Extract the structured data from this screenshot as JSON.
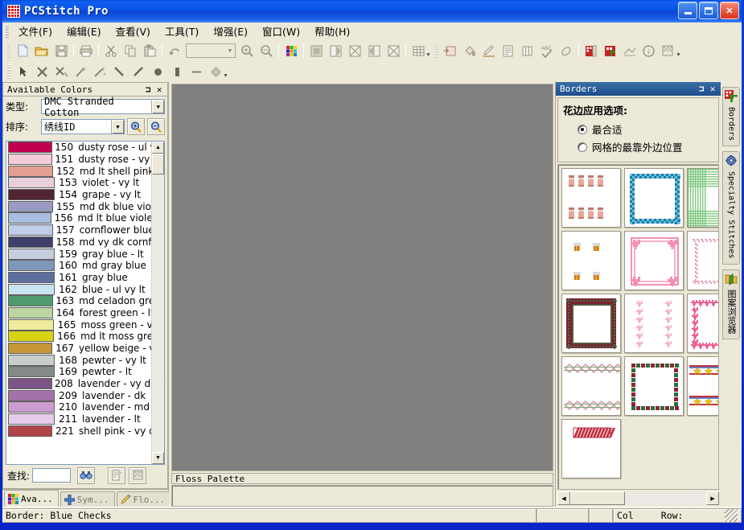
{
  "window": {
    "title": "PCStitch Pro",
    "minimize_label": "Minimize",
    "maximize_label": "Maximize",
    "close_label": "Close"
  },
  "menu": [
    {
      "label": "文件(F)",
      "name": "menu-file"
    },
    {
      "label": "编辑(E)",
      "name": "menu-edit"
    },
    {
      "label": "查看(V)",
      "name": "menu-view"
    },
    {
      "label": "工具(T)",
      "name": "menu-tools"
    },
    {
      "label": "增强(E)",
      "name": "menu-enhance"
    },
    {
      "label": "窗口(W)",
      "name": "menu-window"
    },
    {
      "label": "帮助(H)",
      "name": "menu-help"
    }
  ],
  "toolbar_main": {
    "zoom_value": "",
    "items": [
      "new-icon",
      "open-icon",
      "save-icon",
      "print-icon",
      "cut-icon",
      "copy-icon",
      "paste-icon",
      "undo-icon",
      "zoom-combo",
      "zoom-in-icon",
      "zoom-out-icon",
      "palette-icon",
      "full-stitch-icon",
      "half-stitch-icon",
      "cross-stitch-icon",
      "quarter-stitch-icon",
      "back-stitch-icon",
      "grid-icon",
      "import-icon",
      "fill-icon",
      "pencil-icon",
      "text-icon",
      "columns-icon",
      "spellcheck-icon",
      "eraser-icon",
      "pattern-icon",
      "borders-icon",
      "print-preview-icon",
      "info-icon",
      "chart-icon"
    ]
  },
  "toolbar_tools": {
    "items": [
      "pointer-icon",
      "delete-icon",
      "magic-delete-icon",
      "wand-icon",
      "magic-wand-icon",
      "line-icon",
      "diagonal-icon",
      "ellipse-icon",
      "rectangle-icon",
      "dash-icon",
      "gear-icon"
    ]
  },
  "left_panel": {
    "title": "Available Colors",
    "pin_label": "Pin",
    "close_label": "Close",
    "type_label": "类型:",
    "type_value": "DMC Stranded Cotton",
    "sort_label": "排序:",
    "sort_value": "绣线ID",
    "zoom_in_icon": "zoom-in-icon",
    "zoom_out_icon": "zoom-out-icon",
    "find_label": "查找:",
    "find_value": "",
    "find_button_icon": "binoculars-icon",
    "list_button_icon": "list-icon",
    "grid_button_icon": "grid-icon",
    "colors": [
      {
        "id": "150",
        "name": "dusty rose - ul v",
        "hex": "#c3004f"
      },
      {
        "id": "151",
        "name": "dusty rose - vy l",
        "hex": "#f2ccd7"
      },
      {
        "id": "152",
        "name": "md lt shell pink",
        "hex": "#e3a091"
      },
      {
        "id": "153",
        "name": "violet - vy lt",
        "hex": "#e8cfdb"
      },
      {
        "id": "154",
        "name": "grape - vy lt",
        "hex": "#512433"
      },
      {
        "id": "155",
        "name": "md dk blue viol",
        "hex": "#9a9bc2"
      },
      {
        "id": "156",
        "name": "md lt blue violet",
        "hex": "#a9bddf"
      },
      {
        "id": "157",
        "name": "cornflower blue",
        "hex": "#bfcde9"
      },
      {
        "id": "158",
        "name": "md vy dk cornfl",
        "hex": "#3e3e6b"
      },
      {
        "id": "159",
        "name": "gray blue - lt",
        "hex": "#c4cede"
      },
      {
        "id": "160",
        "name": "md gray blue",
        "hex": "#8097b9"
      },
      {
        "id": "161",
        "name": "gray blue",
        "hex": "#5f6ea0"
      },
      {
        "id": "162",
        "name": "blue - ul vy lt",
        "hex": "#c9e3f2"
      },
      {
        "id": "163",
        "name": "md celadon gre",
        "hex": "#4f9b6f"
      },
      {
        "id": "164",
        "name": "forest green - lt",
        "hex": "#bcd5a3"
      },
      {
        "id": "165",
        "name": "moss green - v",
        "hex": "#eeec9a"
      },
      {
        "id": "166",
        "name": "md lt moss gre",
        "hex": "#d7d416"
      },
      {
        "id": "167",
        "name": "yellow beige - v",
        "hex": "#c49637"
      },
      {
        "id": "168",
        "name": "pewter - vy lt",
        "hex": "#c9cdcc"
      },
      {
        "id": "169",
        "name": "pewter - lt",
        "hex": "#848b87"
      },
      {
        "id": "208",
        "name": "lavender - vy dk",
        "hex": "#7c5586"
      },
      {
        "id": "209",
        "name": "lavender - dk",
        "hex": "#a472ab"
      },
      {
        "id": "210",
        "name": "lavender - md",
        "hex": "#cb9ccd"
      },
      {
        "id": "211",
        "name": "lavender - lt",
        "hex": "#e6ccea"
      },
      {
        "id": "221",
        "name": "shell pink - vy d",
        "hex": "#b04447"
      }
    ],
    "tabs": [
      {
        "label": "Ava...",
        "name": "tab-available-colors",
        "icon": "palette-icon",
        "active": true
      },
      {
        "label": "Sym...",
        "name": "tab-symbols",
        "icon": "plus-icon",
        "active": false
      },
      {
        "label": "Flo...",
        "name": "tab-floss",
        "icon": "pencil-icon",
        "active": false
      }
    ]
  },
  "canvas": {
    "background": "#808080",
    "floss_palette_title": "Floss Palette"
  },
  "right_panel": {
    "title": "Borders",
    "pin_label": "Pin",
    "close_label": "Close",
    "options_heading": "花边应用选项:",
    "options": [
      {
        "label": "最合适",
        "selected": true,
        "name": "radio-best-fit"
      },
      {
        "label": "网格的最靠外边位置",
        "selected": false,
        "name": "radio-outermost-grid"
      }
    ],
    "borders": [
      {
        "name": "border-candles",
        "style": "candles"
      },
      {
        "name": "border-blue-checks",
        "style": "blue-checks"
      },
      {
        "name": "border-green-plaid",
        "style": "green-plaid"
      },
      {
        "name": "border-baskets",
        "style": "baskets"
      },
      {
        "name": "border-pink-hearts-frame",
        "style": "pink-hearts-frame"
      },
      {
        "name": "border-pink-scroll",
        "style": "pink-scroll"
      },
      {
        "name": "border-dark-red-frame",
        "style": "dark-red-frame"
      },
      {
        "name": "border-pink-hearts-column",
        "style": "pink-hearts-column"
      },
      {
        "name": "border-pink-heart-wave",
        "style": "pink-heart-wave"
      },
      {
        "name": "border-diamond-band",
        "style": "diamond-band"
      },
      {
        "name": "border-checker-frame",
        "style": "checker-frame"
      },
      {
        "name": "border-stars-band",
        "style": "stars-band"
      },
      {
        "name": "border-candy-stripe",
        "style": "candy-stripe"
      }
    ]
  },
  "vertical_tabs": [
    {
      "label": "Borders",
      "name": "vtab-borders",
      "icon": "borders-icon",
      "cjk": false
    },
    {
      "label": "Specialty Stitches",
      "name": "vtab-specialty-stitches",
      "icon": "gear-icon",
      "cjk": false
    },
    {
      "label": "图案浏览器",
      "name": "vtab-pattern-browser",
      "icon": "pattern-browser-icon",
      "cjk": true
    }
  ],
  "status_bar": {
    "message": "Border: Blue Checks",
    "col_label": "Col",
    "row_label": "Row:",
    "pane2": "",
    "pane3": ""
  }
}
